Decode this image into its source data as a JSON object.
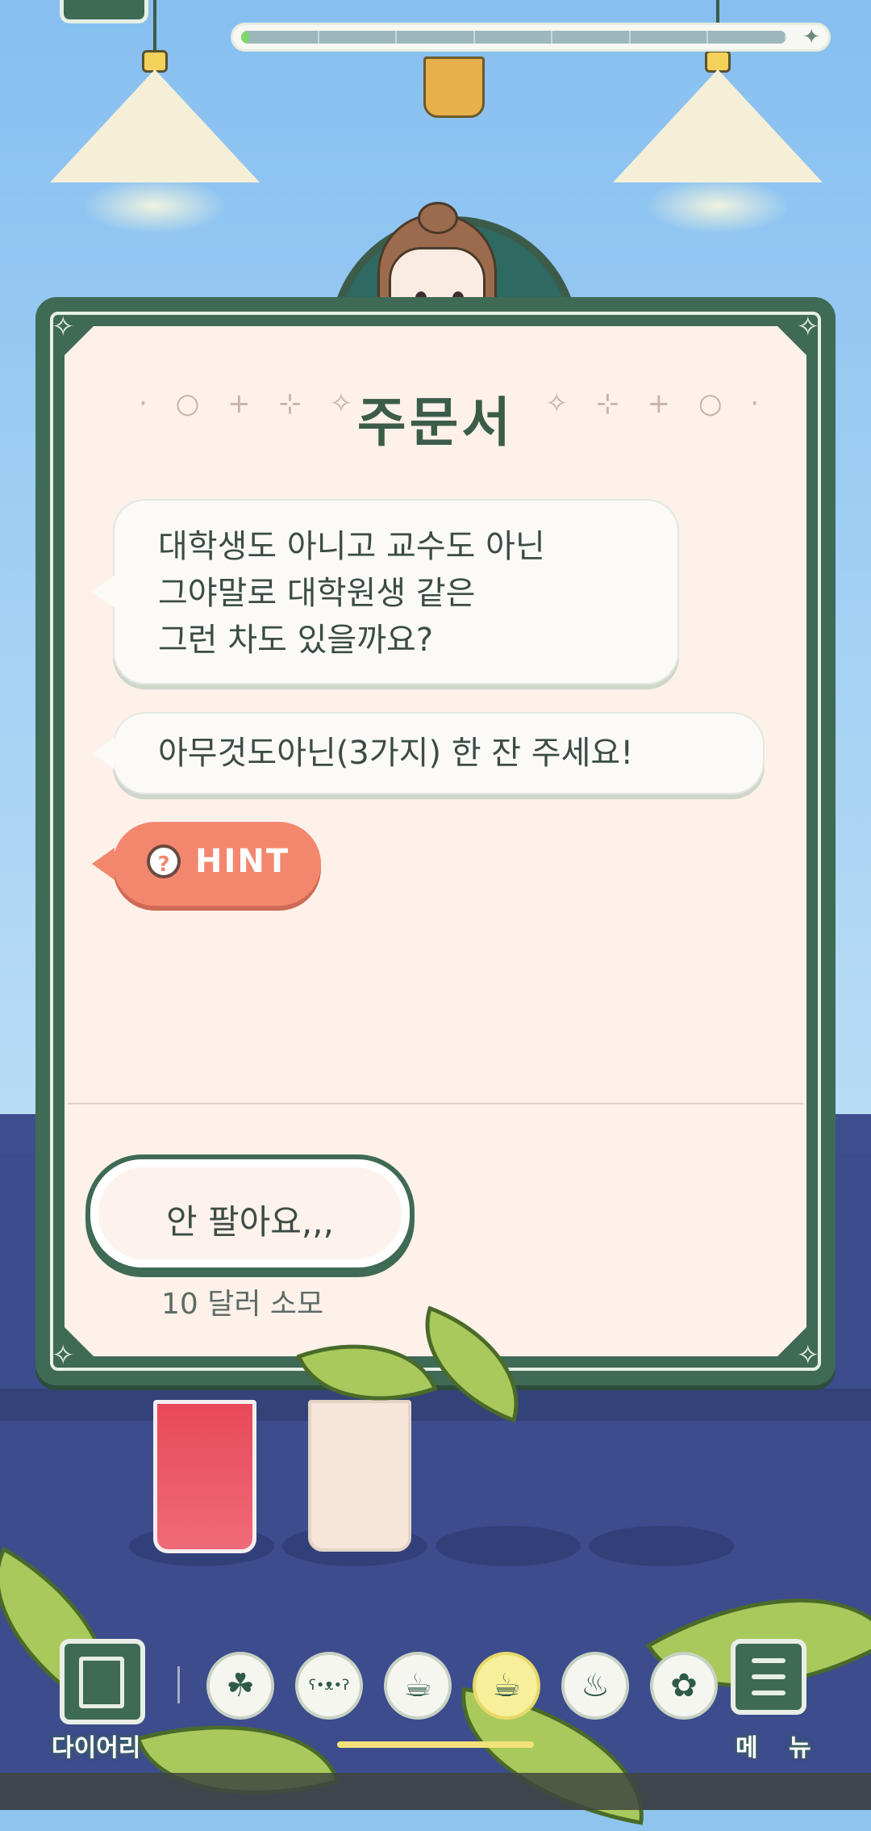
{
  "order": {
    "title": "주문서",
    "title_deco_left": "· ○ + ⊹ ✧",
    "title_deco_right": "✧ ⊹ + ○ ·",
    "messages": [
      "대학생도 아니고 교수도 아닌\n그야말로 대학원생 같은\n그런 차도 있을까요?",
      "아무것도아닌(3가지) 한 잔 주세요!"
    ],
    "hint_label": "HINT",
    "refuse_label": "안 팔아요,,,",
    "refuse_cost": "10 달러 소모"
  },
  "progress": {
    "fill_fraction": 0.015,
    "icon": "sparkle-icon"
  },
  "bottom_nav": {
    "diary_label": "다이어리",
    "menu_label": "메 뉴",
    "categories": [
      {
        "name": "leaf-tea-icon",
        "glyph": "☘",
        "active": false
      },
      {
        "name": "bear-icon",
        "glyph": "ʕ•ᴥ•ʔ",
        "active": false
      },
      {
        "name": "cup-icon",
        "glyph": "☕",
        "active": false
      },
      {
        "name": "cup-icon-selected",
        "glyph": "☕",
        "active": true
      },
      {
        "name": "teapot-icon",
        "glyph": "♨",
        "active": false
      },
      {
        "name": "plant-icon",
        "glyph": "✿",
        "active": false
      }
    ]
  },
  "colors": {
    "card_green": "#3f6a55",
    "paper": "#fdf1ea",
    "hint_coral": "#f2876d",
    "sky": "#8fc4ee",
    "counter": "#3c4c8c"
  }
}
